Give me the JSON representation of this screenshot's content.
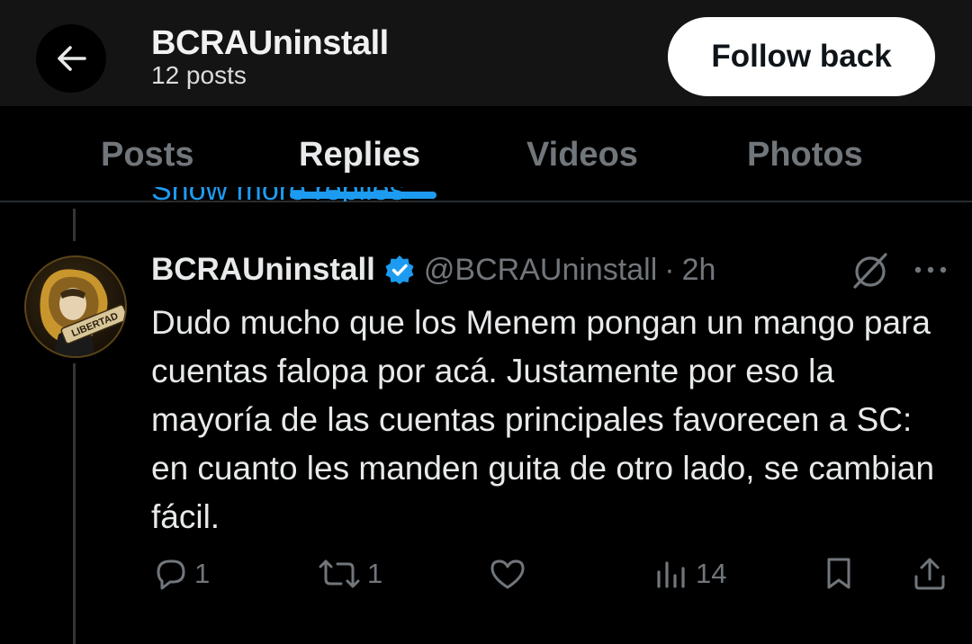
{
  "header": {
    "profile_name": "BCRAUninstall",
    "post_count": "12 posts",
    "follow_label": "Follow back"
  },
  "tabs": [
    {
      "label": "Posts",
      "active": false
    },
    {
      "label": "Replies",
      "active": true
    },
    {
      "label": "Videos",
      "active": false
    },
    {
      "label": "Photos",
      "active": false
    }
  ],
  "hidden_link": "Show more replies",
  "tweet": {
    "author": "BCRAUninstall",
    "handle": "@BCRAUninstall",
    "separator": "·",
    "time": "2h",
    "avatar_text": "LIBERTAD",
    "text": "Dudo mucho que los Menem pongan un mango para cuentas falopa por acá. Justamente por eso la mayoría de las cuentas principales favorecen a SC: en cuanto les manden guita de otro lado, se cambian fácil.",
    "replies": "1",
    "reposts": "1",
    "views": "14"
  },
  "icons": {
    "back": "arrow-left-icon",
    "verified": "verified-badge-icon",
    "grok": "grok-icon",
    "more": "more-horizontal-icon",
    "reply": "reply-bubble-icon",
    "repost": "repost-icon",
    "like": "heart-icon",
    "views": "views-bars-icon",
    "bookmark": "bookmark-icon",
    "share": "share-upload-icon"
  },
  "colors": {
    "accent": "#1d9bf0",
    "muted": "#71767b",
    "text": "#e7e9ea",
    "background": "#000000",
    "header_bg": "#141414"
  }
}
